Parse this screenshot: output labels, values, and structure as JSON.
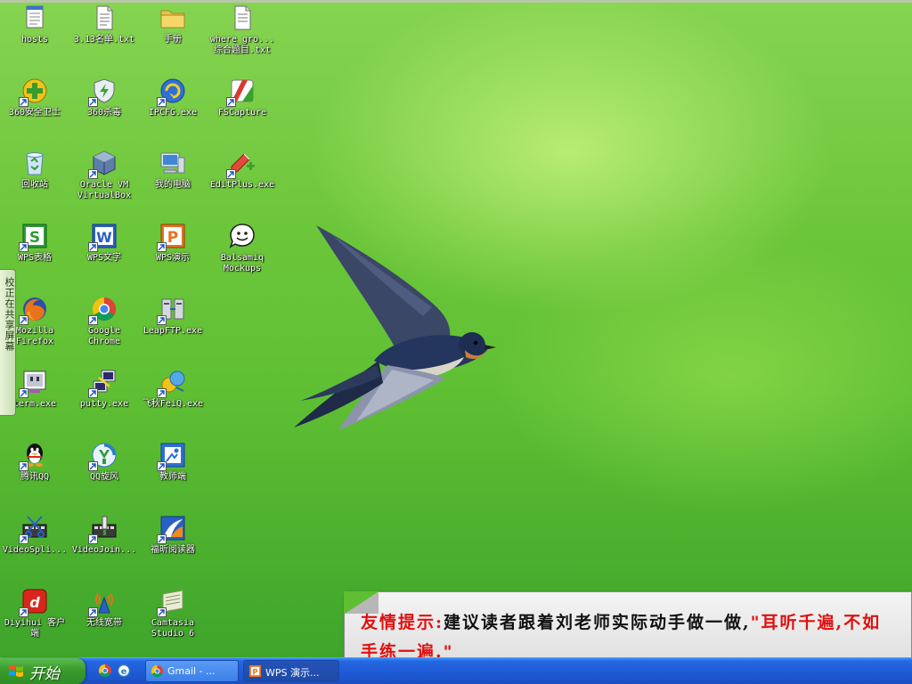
{
  "desktop": {
    "icons": [
      {
        "label": "hosts",
        "icon": "notepad-file-icon"
      },
      {
        "label": "3.13名单.txt",
        "icon": "text-file-icon"
      },
      {
        "label": "手册",
        "icon": "folder-icon"
      },
      {
        "label": "where_gro...\n综合题目.txt",
        "icon": "text-file-icon"
      },
      {
        "label": "360安全卫士",
        "icon": "360-safe-icon"
      },
      {
        "label": "360杀毒",
        "icon": "360-antivirus-icon"
      },
      {
        "label": "IPCFG.exe",
        "icon": "ipcfg-icon"
      },
      {
        "label": "FSCapture",
        "icon": "fscapture-icon"
      },
      {
        "label": "回收站",
        "icon": "recycle-bin-icon"
      },
      {
        "label": "Oracle VM\nVirtualBox",
        "icon": "virtualbox-icon"
      },
      {
        "label": "我的电脑",
        "icon": "my-computer-icon"
      },
      {
        "label": "EditPlus.exe",
        "icon": "editplus-icon"
      },
      {
        "label": "WPS表格",
        "icon": "wps-spreadsheet-icon"
      },
      {
        "label": "WPS文字",
        "icon": "wps-writer-icon"
      },
      {
        "label": "WPS演示",
        "icon": "wps-presentation-icon"
      },
      {
        "label": "Balsamiq\nMockups",
        "icon": "balsamiq-icon"
      },
      {
        "label": "Mozilla\nFirefox",
        "icon": "firefox-icon"
      },
      {
        "label": "Google\nChrome",
        "icon": "chrome-icon"
      },
      {
        "label": "LeapFTP.exe",
        "icon": "leapftp-icon"
      },
      {
        "label": "term.exe",
        "icon": "terminal-icon"
      },
      {
        "label": "putty.exe",
        "icon": "putty-icon"
      },
      {
        "label": "飞秋FeiQ.exe",
        "icon": "feiq-icon"
      },
      {
        "label": "腾讯QQ",
        "icon": "qq-icon"
      },
      {
        "label": "QQ旋风",
        "icon": "qq-whirlwind-icon"
      },
      {
        "label": "教师端",
        "icon": "teacher-client-icon"
      },
      {
        "label": "VideoSpli...",
        "icon": "video-splitter-icon"
      },
      {
        "label": "VideoJoin...",
        "icon": "video-joiner-icon"
      },
      {
        "label": "福昕阅读器",
        "icon": "foxit-reader-icon"
      },
      {
        "label": "Diyihui 客户\n端",
        "icon": "diyihui-client-icon"
      },
      {
        "label": "无线宽带",
        "icon": "wireless-broadband-icon"
      },
      {
        "label": "Camtasia\nStudio 6",
        "icon": "camtasia-icon"
      }
    ]
  },
  "side_tab": {
    "label": "校正在共享屏幕"
  },
  "tip": {
    "prefix": "友情提示:",
    "body": "建议读者跟着刘老师实际动手做一做,",
    "quote": "\"耳听千遍,不如手练一遍.\""
  },
  "taskbar": {
    "start_label": "开始",
    "quick_launch": [
      {
        "icon": "chrome-icon"
      },
      {
        "icon": "ie-icon"
      }
    ],
    "tasks": [
      {
        "label": "Gmail - ...",
        "icon": "chrome-icon",
        "active": false
      },
      {
        "label": "WPS 演示...",
        "icon": "wps-presentation-icon",
        "active": true
      }
    ]
  },
  "colors": {
    "taskbar_blue": "#2567e2",
    "start_green": "#3a9a2e",
    "tip_red": "#e01010",
    "desktop_green": "#6cc63a"
  }
}
